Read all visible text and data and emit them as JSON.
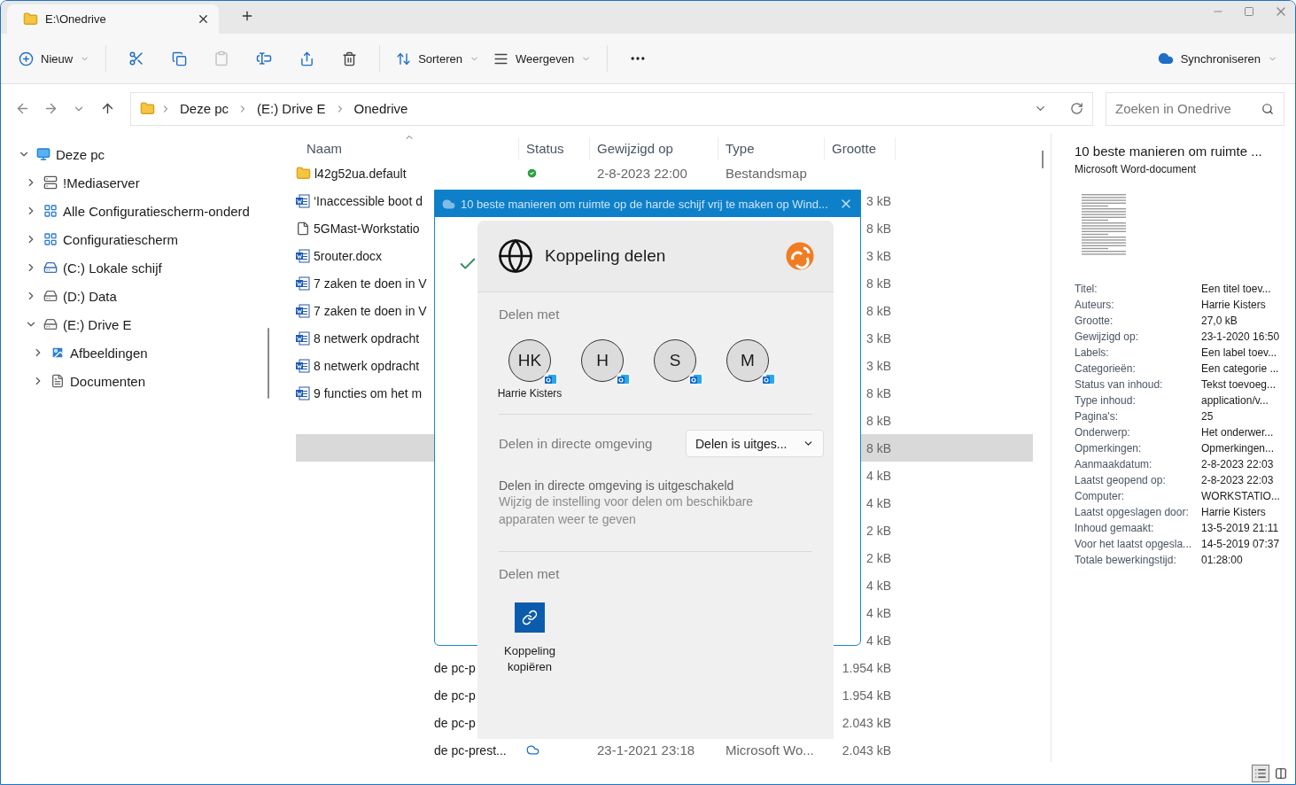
{
  "window": {
    "tabs": [
      {
        "label": "E:\\Onedrive",
        "selected": true
      }
    ]
  },
  "toolbar": {
    "new": "Nieuw",
    "paste_disabled": true,
    "sort": "Sorteren",
    "view": "Weergeven",
    "sync": "Synchroniseren"
  },
  "address": {
    "path": [
      "Deze pc",
      "(E:) Drive E",
      "Onedrive"
    ],
    "search": {
      "placeholder": "Zoeken in Onedrive"
    }
  },
  "nav": [
    {
      "label": "Deze pc",
      "kind": "pc",
      "expanded": true,
      "children": [
        {
          "label": "!Mediaserver",
          "kind": "server",
          "expanded": false
        },
        {
          "label": "Alle Configuratiescherm-onderd",
          "kind": "panel",
          "expanded": false
        },
        {
          "label": "Configuratiescherm",
          "kind": "panel",
          "expanded": false
        },
        {
          "label": "(C:) Lokale schijf",
          "kind": "system",
          "expanded": false
        },
        {
          "label": "(D:) Data",
          "kind": "drive",
          "expanded": false
        },
        {
          "label": "(E:) Drive E",
          "kind": "drive",
          "expanded": true,
          "children": [
            {
              "label": "Afbeeldingen",
              "kind": "pictures",
              "expanded": false
            },
            {
              "label": "Documenten",
              "kind": "documents",
              "expanded": false
            }
          ]
        }
      ]
    }
  ],
  "file_list": {
    "columns": [
      "Naam",
      "Status",
      "Gewijzigd op",
      "Type",
      "Grootte"
    ],
    "rows": [
      {
        "kind": "folder",
        "name": "l42g52ua.default",
        "synced": true,
        "modified": "2-8-2023 22:00",
        "type": "Bestandsmap",
        "selected": false
      },
      {
        "kind": "word",
        "name": "‘Inaccessible boot d",
        "size": "3 kB",
        "selected": false
      },
      {
        "kind": "file",
        "name": "5GMast-Workstatio",
        "size": "8 kB",
        "selected": false
      },
      {
        "kind": "word",
        "name": "5router.docx",
        "size": "3 kB",
        "selected": false
      },
      {
        "kind": "word",
        "name": "7 zaken te doen in V",
        "size": "8 kB",
        "selected": false
      },
      {
        "kind": "word",
        "name": "7 zaken te doen in V",
        "size": "8 kB",
        "selected": false
      },
      {
        "kind": "word",
        "name": "8 netwerk opdracht",
        "size": "3 kB",
        "selected": false
      },
      {
        "kind": "word",
        "name": "8 netwerk opdracht",
        "size": "3 kB",
        "selected": false
      },
      {
        "kind": "word",
        "name": "9 functies om het m",
        "size": "8 kB",
        "selected": false
      }
    ],
    "lower_rows": [
      {
        "size": "8 kB",
        "selected": false
      },
      {
        "size": "8 kB",
        "selected": true
      },
      {
        "size": "4 kB",
        "selected": false
      },
      {
        "size": "4 kB",
        "selected": false
      },
      {
        "size": "2 kB",
        "selected": false
      },
      {
        "size": "2 kB",
        "selected": false
      },
      {
        "size": "4 kB",
        "selected": false
      },
      {
        "size": "4 kB",
        "selected": false
      },
      {
        "size": "4 kB",
        "selected": false
      },
      {
        "name": "de pc-p",
        "size": "1.954 kB",
        "selected": false
      },
      {
        "name": "de pc-p",
        "size": "1.954 kB",
        "selected": false
      },
      {
        "name": "de pc-p",
        "size": "2.043 kB",
        "selected": false
      },
      {
        "name": "de pc-prest...",
        "online_only": true,
        "modified": "23-1-2021 23:18",
        "type": "Microsoft Wo...",
        "size": "2.043 kB",
        "selected": false
      }
    ]
  },
  "share_dialog": {
    "title": "10 beste manieren om ruimte op de harde schijf vrij te maken op Wind...",
    "header": "Koppeling delen",
    "share_with": "Delen met",
    "contacts": [
      {
        "initials": "HK",
        "name": "Harrie Kisters"
      },
      {
        "initials": "H"
      },
      {
        "initials": "S"
      },
      {
        "initials": "M"
      }
    ],
    "nearby_label": "Delen in directe omgeving",
    "nearby_value": "Delen is uitges...",
    "nearby_info": "Delen in directe omgeving is uitgeschakeld",
    "nearby_hint": "Wijzig de instelling voor delen om beschikbare apparaten weer te geven",
    "share_with_2": "Delen met",
    "copy_link": "Koppeling kopiëren"
  },
  "details": {
    "title": "10 beste manieren om ruimte ...",
    "subtitle": "Microsoft Word-document",
    "properties": [
      {
        "label": "Titel:",
        "value": "Een titel toev..."
      },
      {
        "label": "Auteurs:",
        "value": "Harrie Kisters"
      },
      {
        "label": "Grootte:",
        "value": "27,0 kB"
      },
      {
        "label": "Gewijzigd op:",
        "value": "23-1-2020 16:50"
      },
      {
        "label": "Labels:",
        "value": "Een label toev..."
      },
      {
        "label": "Categorieën:",
        "value": "Een categorie ..."
      },
      {
        "label": "Status van inhoud:",
        "value": "Tekst toevoeg..."
      },
      {
        "label": "Type inhoud:",
        "value": "application/v..."
      },
      {
        "label": "Pagina's:",
        "value": "25"
      },
      {
        "label": "Onderwerp:",
        "value": "Het onderwer..."
      },
      {
        "label": "Opmerkingen:",
        "value": "Opmerkingen..."
      },
      {
        "label": "Aanmaakdatum:",
        "value": "2-8-2023 22:03"
      },
      {
        "label": "Laatst geopend op:",
        "value": "2-8-2023 22:03"
      },
      {
        "label": "Computer:",
        "value": "WORKSTATIO..."
      },
      {
        "label": "Laatst opgeslagen door:",
        "value": "Harrie Kisters"
      },
      {
        "label": "Inhoud gemaakt:",
        "value": "13-5-2019 21:11"
      },
      {
        "label": "Voor het laatst opgesla...",
        "value": "14-5-2019 07:37"
      },
      {
        "label": "Totale bewerkingstijd:",
        "value": "01:28:00"
      }
    ]
  },
  "status_bar": {
    "views": [
      {
        "kind": "details",
        "selected": true
      },
      {
        "kind": "tiles",
        "selected": false
      }
    ]
  }
}
